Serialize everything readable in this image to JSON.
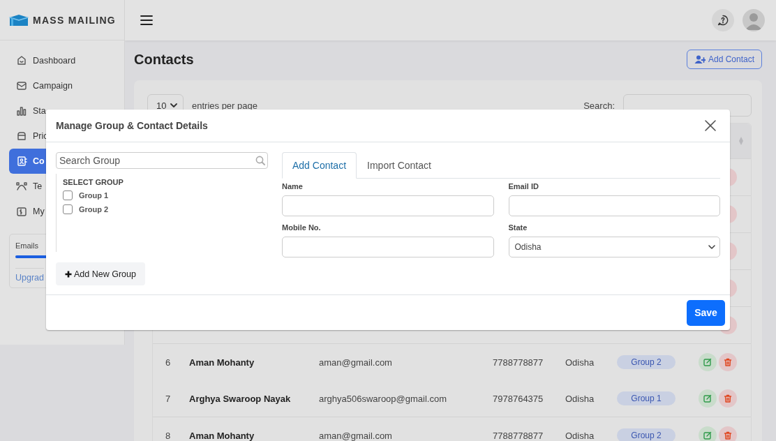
{
  "brand": {
    "name": "MASS MAILING"
  },
  "sidebar": {
    "items": [
      {
        "label": "Dashboard",
        "selected": false
      },
      {
        "label": "Campaign",
        "selected": false
      },
      {
        "label": "Sta",
        "selected": false
      },
      {
        "label": "Pric",
        "selected": false
      },
      {
        "label": "Co",
        "selected": true
      },
      {
        "label": "Te",
        "selected": false
      },
      {
        "label": "My",
        "selected": false
      }
    ],
    "usage": {
      "label": "Emails",
      "level": 1,
      "link": "Upgrad"
    }
  },
  "page": {
    "title": "Contacts",
    "add_button": "Add Contact"
  },
  "controls": {
    "entries_value": "10",
    "entries_label": "entries per page",
    "search_label": "Search:"
  },
  "table": {
    "rows": [
      {
        "kind": "covered"
      },
      {
        "kind": "covered"
      },
      {
        "kind": "covered"
      },
      {
        "kind": "covered"
      },
      {
        "kind": "covered"
      },
      {
        "kind": "full",
        "index": "6",
        "name": "Aman Mohanty",
        "email": "aman@gmail.com",
        "phone": "7788778877",
        "state": "Odisha",
        "group": "Group 2"
      },
      {
        "kind": "full",
        "index": "7",
        "name": "Arghya Swaroop Nayak",
        "email": "arghya506swaroop@gmail.com",
        "phone": "7978764375",
        "state": "Odisha",
        "group": "Group 1"
      },
      {
        "kind": "full",
        "index": "8",
        "name": "Aman Mohanty",
        "email": "aman@gmail.com",
        "phone": "7788778877",
        "state": "Odisha",
        "group": "Group 2"
      }
    ]
  },
  "modal": {
    "title": "Manage Group & Contact Details",
    "search": {
      "placeholder": "Search Group"
    },
    "group_heading": "SELECT GROUP",
    "groups": [
      {
        "label": "Group 1",
        "checked": false
      },
      {
        "label": "Group 2",
        "checked": false
      }
    ],
    "add_group_button": "Add New Group",
    "tabs": [
      {
        "label": "Add Contact",
        "selected": true
      },
      {
        "label": "Import Contact",
        "selected": false
      }
    ],
    "fields": [
      {
        "label": "Name",
        "kind": "text"
      },
      {
        "label": "Email ID",
        "kind": "text"
      },
      {
        "label": "Mobile No.",
        "kind": "text"
      },
      {
        "label": "State",
        "kind": "select",
        "value": "Odisha"
      }
    ],
    "save_button": "Save"
  }
}
